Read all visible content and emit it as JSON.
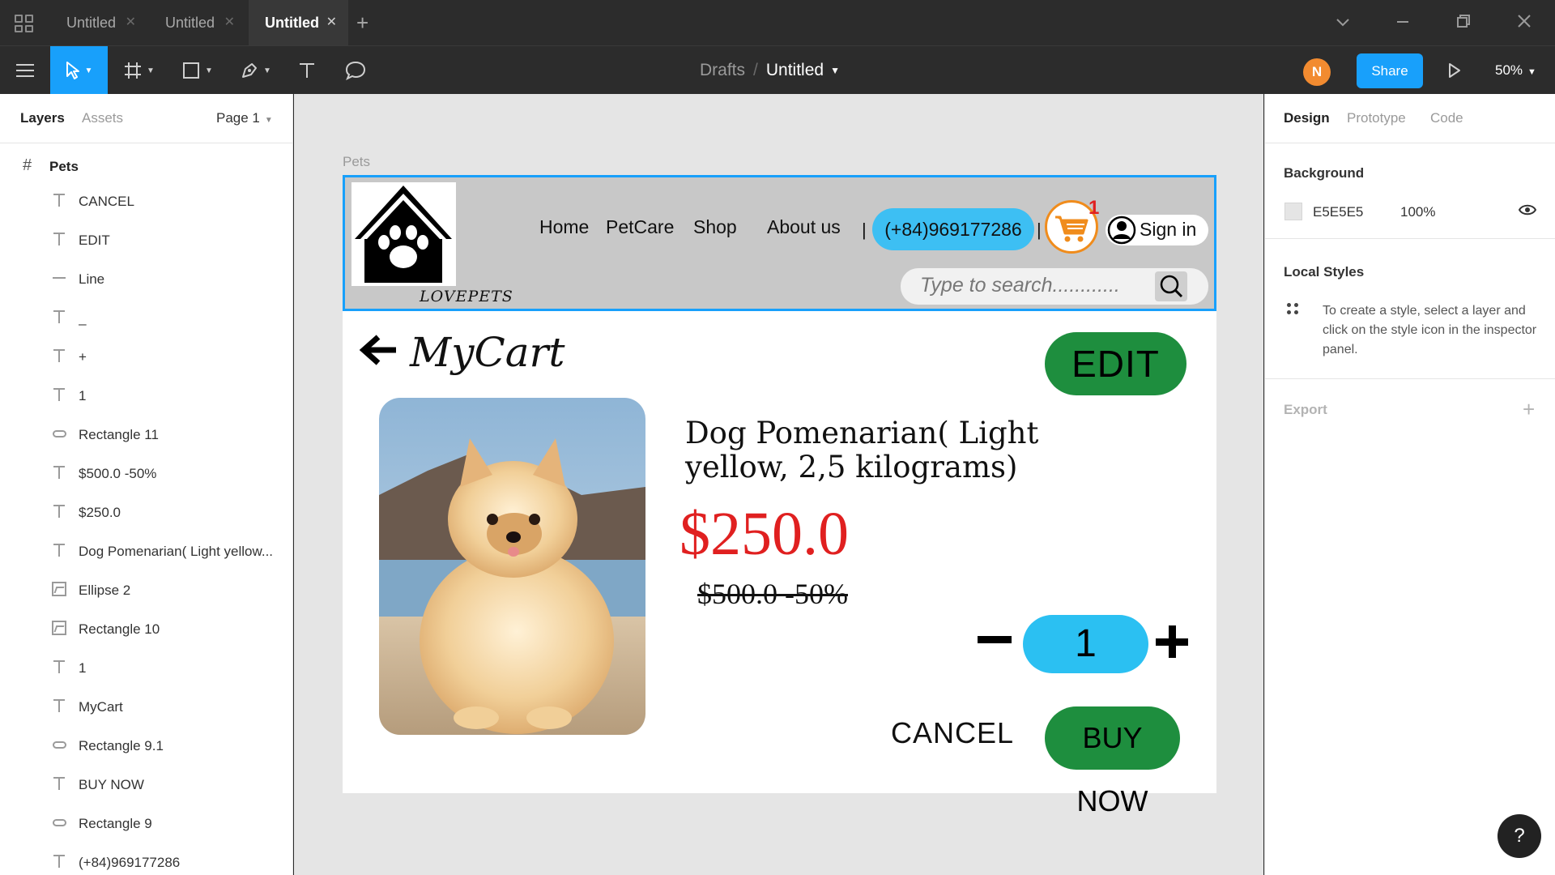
{
  "tabs": [
    {
      "label": "Untitled"
    },
    {
      "label": "Untitled"
    },
    {
      "label": "Untitled"
    }
  ],
  "breadcrumb": {
    "parent": "Drafts",
    "current": "Untitled"
  },
  "toolbar": {
    "avatar_initial": "N",
    "share_label": "Share",
    "zoom": "50%"
  },
  "left_panel": {
    "tab_layers": "Layers",
    "tab_assets": "Assets",
    "page": "Page 1",
    "frame_name": "Pets",
    "layers": [
      {
        "icon": "text-icon",
        "name": "CANCEL"
      },
      {
        "icon": "text-icon",
        "name": "EDIT"
      },
      {
        "icon": "line-icon",
        "name": "Line"
      },
      {
        "icon": "text-icon",
        "name": "_"
      },
      {
        "icon": "text-icon",
        "name": "+"
      },
      {
        "icon": "text-icon",
        "name": "1"
      },
      {
        "icon": "rectangle-icon",
        "name": "Rectangle 11"
      },
      {
        "icon": "text-icon",
        "name": "$500.0 -50%"
      },
      {
        "icon": "text-icon",
        "name": "$250.0"
      },
      {
        "icon": "text-icon",
        "name": "Dog Pomenarian( Light yellow..."
      },
      {
        "icon": "image-icon",
        "name": "Ellipse 2"
      },
      {
        "icon": "image-icon",
        "name": "Rectangle 10"
      },
      {
        "icon": "text-icon",
        "name": "1"
      },
      {
        "icon": "text-icon",
        "name": "MyCart"
      },
      {
        "icon": "rectangle-icon",
        "name": "Rectangle 9.1"
      },
      {
        "icon": "text-icon",
        "name": "BUY NOW"
      },
      {
        "icon": "rectangle-icon",
        "name": "Rectangle 9"
      },
      {
        "icon": "text-icon",
        "name": "(+84)969177286"
      }
    ]
  },
  "right_panel": {
    "tab_design": "Design",
    "tab_prototype": "Prototype",
    "tab_code": "Code",
    "background_title": "Background",
    "background_hex": "E5E5E5",
    "background_opacity": "100%",
    "local_styles_title": "Local Styles",
    "local_styles_hint": "To create a style, select a layer and click on the style icon in the inspector panel.",
    "export_title": "Export",
    "help": "?"
  },
  "canvas": {
    "frame_label": "Pets",
    "header": {
      "logo_text": "LOVEPETS",
      "nav": [
        "Home",
        "PetCare",
        "Shop",
        "About us"
      ],
      "pipe": "|",
      "phone": "(+84)969177286",
      "cart_badge": "1",
      "signin": "Sign in",
      "search_placeholder": "Type to search............"
    },
    "page_title": "MyCart",
    "edit_label": "EDIT",
    "product_title": "Dog Pomenarian( Light yellow, 2,5 kilograms)",
    "price": "$250.0",
    "old_price": "$500.0 -50%",
    "quantity": "1",
    "cancel_label": "CANCEL",
    "buy_label": "BUY NOW"
  },
  "colors": {
    "accent": "#18a0fb",
    "canvas_bg": "#E5E5E5",
    "button_green": "#1e8e3e",
    "price_red": "#e02020",
    "phone_blue": "#3dbff3"
  }
}
